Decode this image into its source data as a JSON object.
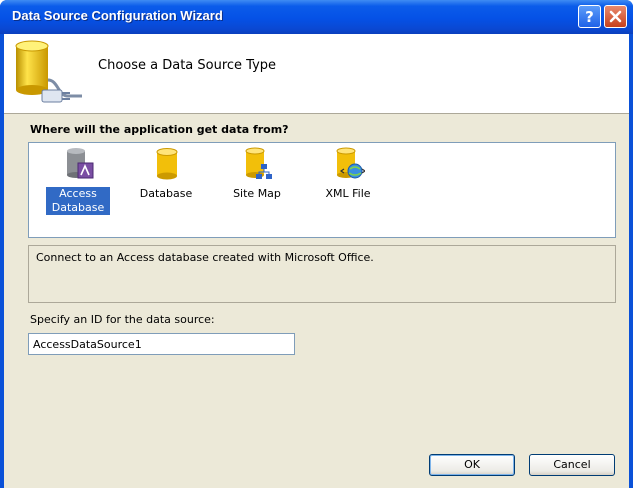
{
  "window": {
    "title": "Data Source Configuration Wizard",
    "help_button": "?",
    "close_button": "✕"
  },
  "header": {
    "title": "Choose a Data Source Type",
    "icon": "database-plug-icon"
  },
  "prompt": "Where will the application get data from?",
  "source_types": [
    {
      "label_line1": "Access",
      "label_line2": "Database",
      "icon": "access-database-icon",
      "selected": true
    },
    {
      "label_line1": "Database",
      "label_line2": "",
      "icon": "database-icon",
      "selected": false
    },
    {
      "label_line1": "Site Map",
      "label_line2": "",
      "icon": "site-map-icon",
      "selected": false
    },
    {
      "label_line1": "XML File",
      "label_line2": "",
      "icon": "xml-file-icon",
      "selected": false
    }
  ],
  "description": "Connect to an Access database created with Microsoft Office.",
  "id_field": {
    "label": "Specify an ID for the data source:",
    "value": "AccessDataSource1"
  },
  "buttons": {
    "ok": "OK",
    "cancel": "Cancel"
  },
  "colors": {
    "titlebar": "#0551e6",
    "selection": "#316ac5",
    "dialog_face": "#ece9d8"
  }
}
